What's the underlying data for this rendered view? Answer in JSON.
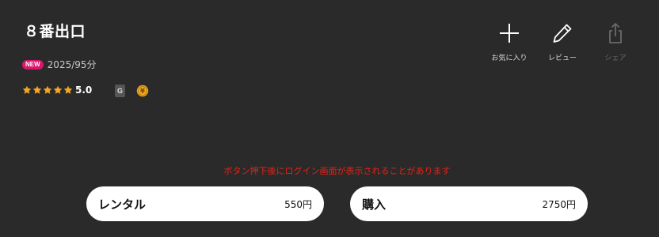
{
  "title": "８番出口",
  "meta": {
    "badge": "NEW",
    "info": "2025/95分"
  },
  "rating": {
    "value": 5.0,
    "display": "5.0",
    "max": 5,
    "star_color": "#f5a623"
  },
  "age_rating": "G",
  "coin_symbol": "¥",
  "actions": {
    "favorite": "お気に入り",
    "review": "レビュー",
    "share": "シェア"
  },
  "notice": "ボタン押下後にログイン画面が表示されることがあります",
  "purchase": {
    "rental": {
      "label": "レンタル",
      "price": "550円"
    },
    "buy": {
      "label": "購入",
      "price": "2750円"
    }
  },
  "colors": {
    "background": "#2a2a2a",
    "new_badge": "#d8176b",
    "notice": "#e62117",
    "coin": "#f0a81c"
  }
}
